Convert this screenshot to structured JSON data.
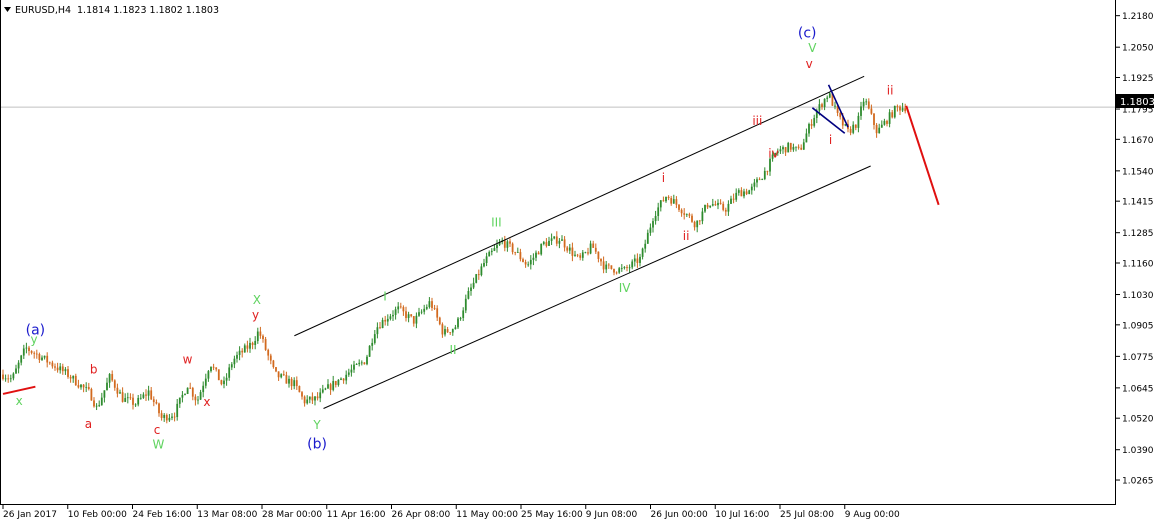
{
  "header": {
    "symbol_label": "EURUSD,H4",
    "ohlc_label": "1.1814 1.1823 1.1802 1.1803"
  },
  "chart_data": {
    "type": "candlestick",
    "ylim": [
      1.0195,
      1.2224
    ],
    "y_ticks": [
      "1.2180",
      "1.2050",
      "1.1925",
      "1.1795",
      "1.1670",
      "1.1540",
      "1.1415",
      "1.1285",
      "1.1160",
      "1.1030",
      "1.0905",
      "1.0775",
      "1.0645",
      "1.0520",
      "1.0390",
      "1.0265"
    ],
    "x_labels": [
      "26 Jan 2017",
      "10 Feb 00:00",
      "24 Feb 16:00",
      "13 Mar 08:00",
      "28 Mar 00:00",
      "11 Apr 16:00",
      "26 Apr 08:00",
      "11 May 00:00",
      "25 May 16:00",
      "9 Jun 08:00",
      "26 Jun 00:00",
      "10 Jul 16:00",
      "25 Jul 08:00",
      "9 Aug 00:00"
    ],
    "current_price": "1.1803",
    "colors": {
      "bull": "#2e8b2e",
      "bear": "#d2691e",
      "label_blue": "#1a1acc",
      "label_green": "#5fd35f",
      "label_red": "#e02020",
      "projection": "#e01010",
      "channel": "#000000",
      "small_channel": "#000080",
      "grid_price_line": "#c0c0c0"
    },
    "price_path": [
      {
        "t": 0.0,
        "p": 1.07
      },
      {
        "t": 0.14,
        "p": 1.068
      },
      {
        "t": 0.35,
        "p": 1.081
      },
      {
        "t": 0.6,
        "p": 1.077
      },
      {
        "t": 1.0,
        "p": 1.07
      },
      {
        "t": 1.35,
        "p": 1.062
      },
      {
        "t": 1.45,
        "p": 1.056
      },
      {
        "t": 1.65,
        "p": 1.069
      },
      {
        "t": 1.85,
        "p": 1.06
      },
      {
        "t": 2.05,
        "p": 1.058
      },
      {
        "t": 2.25,
        "p": 1.063
      },
      {
        "t": 2.45,
        "p": 1.052
      },
      {
        "t": 2.65,
        "p": 1.054
      },
      {
        "t": 2.85,
        "p": 1.066
      },
      {
        "t": 3.0,
        "p": 1.059
      },
      {
        "t": 3.2,
        "p": 1.075
      },
      {
        "t": 3.4,
        "p": 1.065
      },
      {
        "t": 3.55,
        "p": 1.076
      },
      {
        "t": 3.85,
        "p": 1.083
      },
      {
        "t": 3.95,
        "p": 1.088
      },
      {
        "t": 4.2,
        "p": 1.07
      },
      {
        "t": 4.5,
        "p": 1.066
      },
      {
        "t": 4.65,
        "p": 1.059
      },
      {
        "t": 4.85,
        "p": 1.06
      },
      {
        "t": 5.0,
        "p": 1.064
      },
      {
        "t": 5.3,
        "p": 1.07
      },
      {
        "t": 5.6,
        "p": 1.076
      },
      {
        "t": 5.75,
        "p": 1.089
      },
      {
        "t": 5.9,
        "p": 1.093
      },
      {
        "t": 6.1,
        "p": 1.097
      },
      {
        "t": 6.35,
        "p": 1.092
      },
      {
        "t": 6.6,
        "p": 1.1
      },
      {
        "t": 6.8,
        "p": 1.087
      },
      {
        "t": 7.0,
        "p": 1.09
      },
      {
        "t": 7.2,
        "p": 1.104
      },
      {
        "t": 7.45,
        "p": 1.117
      },
      {
        "t": 7.7,
        "p": 1.125
      },
      {
        "t": 7.9,
        "p": 1.121
      },
      {
        "t": 8.1,
        "p": 1.115
      },
      {
        "t": 8.35,
        "p": 1.124
      },
      {
        "t": 8.6,
        "p": 1.126
      },
      {
        "t": 8.9,
        "p": 1.117
      },
      {
        "t": 9.1,
        "p": 1.123
      },
      {
        "t": 9.3,
        "p": 1.114
      },
      {
        "t": 9.6,
        "p": 1.113
      },
      {
        "t": 9.85,
        "p": 1.118
      },
      {
        "t": 10.05,
        "p": 1.136
      },
      {
        "t": 10.25,
        "p": 1.144
      },
      {
        "t": 10.45,
        "p": 1.139
      },
      {
        "t": 10.7,
        "p": 1.132
      },
      {
        "t": 10.9,
        "p": 1.141
      },
      {
        "t": 11.15,
        "p": 1.138
      },
      {
        "t": 11.35,
        "p": 1.145
      },
      {
        "t": 11.55,
        "p": 1.146
      },
      {
        "t": 11.75,
        "p": 1.153
      },
      {
        "t": 11.95,
        "p": 1.162
      },
      {
        "t": 12.15,
        "p": 1.164
      },
      {
        "t": 12.3,
        "p": 1.162
      },
      {
        "t": 12.45,
        "p": 1.172
      },
      {
        "t": 12.55,
        "p": 1.178
      },
      {
        "t": 12.75,
        "p": 1.186
      },
      {
        "t": 12.9,
        "p": 1.176
      },
      {
        "t": 13.05,
        "p": 1.17
      },
      {
        "t": 13.2,
        "p": 1.174
      },
      {
        "t": 13.3,
        "p": 1.184
      },
      {
        "t": 13.5,
        "p": 1.17
      },
      {
        "t": 13.65,
        "p": 1.175
      },
      {
        "t": 13.8,
        "p": 1.18
      },
      {
        "t": 13.95,
        "p": 1.1803
      }
    ],
    "channels": [
      {
        "name": "main-upper",
        "from": {
          "t": 4.5,
          "p": 1.086
        },
        "to": {
          "t": 13.3,
          "p": 1.193
        }
      },
      {
        "name": "main-lower",
        "from": {
          "t": 4.95,
          "p": 1.056
        },
        "to": {
          "t": 13.4,
          "p": 1.156
        }
      },
      {
        "name": "small-upper",
        "from": {
          "t": 12.75,
          "p": 1.1895
        },
        "to": {
          "t": 13.05,
          "p": 1.172
        }
      },
      {
        "name": "small-lower",
        "from": {
          "t": 12.5,
          "p": 1.18
        },
        "to": {
          "t": 13.0,
          "p": 1.1695
        }
      }
    ],
    "projections": [
      {
        "name": "projection-line",
        "from": {
          "t": 13.95,
          "p": 1.1808
        },
        "to": {
          "t": 14.45,
          "p": 1.14
        }
      },
      {
        "name": "start-marker",
        "from": {
          "t": 0.0,
          "p": 1.062
        },
        "to": {
          "t": 0.5,
          "p": 1.065
        }
      }
    ],
    "annotations": [
      {
        "text": "(a)",
        "t": 0.5,
        "p": 1.0865,
        "color": "label_blue",
        "size": 14
      },
      {
        "text": "y",
        "t": 0.48,
        "p": 1.0828,
        "color": "label_green",
        "size": 12
      },
      {
        "text": "x",
        "t": 0.25,
        "p": 1.0575,
        "color": "label_green",
        "size": 12
      },
      {
        "text": "b",
        "t": 1.4,
        "p": 1.0705,
        "color": "label_red",
        "size": 12
      },
      {
        "text": "a",
        "t": 1.32,
        "p": 1.048,
        "color": "label_red",
        "size": 12
      },
      {
        "text": "c",
        "t": 2.38,
        "p": 1.0455,
        "color": "label_red",
        "size": 12
      },
      {
        "text": "W",
        "t": 2.4,
        "p": 1.0395,
        "color": "label_green",
        "size": 12
      },
      {
        "text": "w",
        "t": 2.85,
        "p": 1.0745,
        "color": "label_red",
        "size": 12
      },
      {
        "text": "x",
        "t": 3.15,
        "p": 1.057,
        "color": "label_red",
        "size": 12
      },
      {
        "text": "X",
        "t": 3.92,
        "p": 1.099,
        "color": "label_green",
        "size": 12
      },
      {
        "text": "y",
        "t": 3.9,
        "p": 1.093,
        "color": "label_red",
        "size": 12
      },
      {
        "text": "Y",
        "t": 4.85,
        "p": 1.0475,
        "color": "label_green",
        "size": 12
      },
      {
        "text": "(b)",
        "t": 4.85,
        "p": 1.0395,
        "color": "label_blue",
        "size": 14
      },
      {
        "text": "I",
        "t": 5.9,
        "p": 1.1005,
        "color": "label_green",
        "size": 12
      },
      {
        "text": "II",
        "t": 6.95,
        "p": 1.0785,
        "color": "label_green",
        "size": 12
      },
      {
        "text": "III",
        "t": 7.62,
        "p": 1.131,
        "color": "label_green",
        "size": 12
      },
      {
        "text": "IV",
        "t": 9.6,
        "p": 1.104,
        "color": "label_green",
        "size": 12
      },
      {
        "text": "i",
        "t": 10.2,
        "p": 1.1495,
        "color": "label_red",
        "size": 12
      },
      {
        "text": "ii",
        "t": 10.55,
        "p": 1.1255,
        "color": "label_red",
        "size": 12
      },
      {
        "text": "iii",
        "t": 11.65,
        "p": 1.173,
        "color": "label_red",
        "size": 12
      },
      {
        "text": "iv",
        "t": 11.9,
        "p": 1.1595,
        "color": "label_red",
        "size": 12
      },
      {
        "text": "V",
        "t": 12.5,
        "p": 1.203,
        "color": "label_green",
        "size": 12
      },
      {
        "text": "v",
        "t": 12.45,
        "p": 1.1965,
        "color": "label_red",
        "size": 12
      },
      {
        "text": "(c)",
        "t": 12.42,
        "p": 1.209,
        "color": "label_blue",
        "size": 14
      },
      {
        "text": "i",
        "t": 12.78,
        "p": 1.165,
        "color": "label_red",
        "size": 12
      },
      {
        "text": "ii",
        "t": 13.7,
        "p": 1.1855,
        "color": "label_red",
        "size": 12
      }
    ]
  }
}
